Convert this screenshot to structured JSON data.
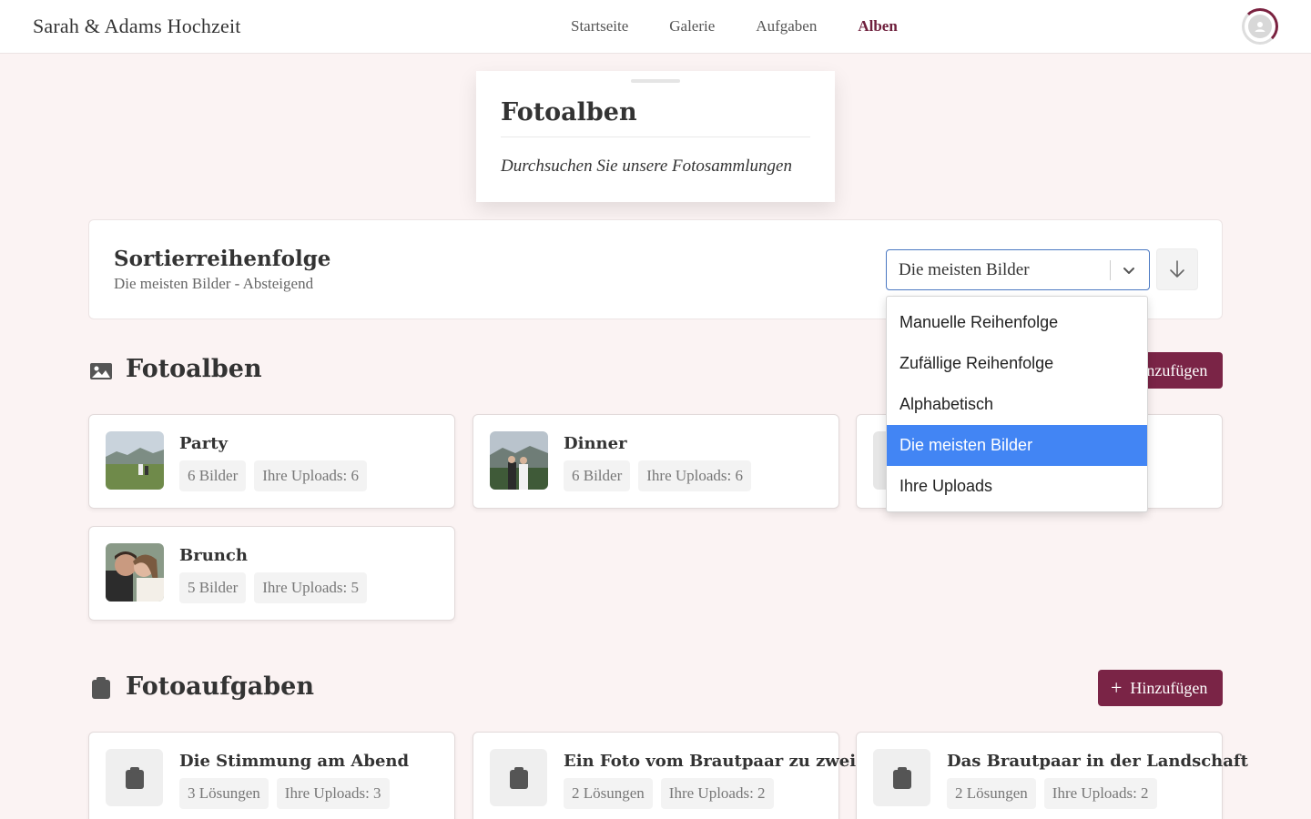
{
  "header": {
    "brand": "Sarah & Adams Hochzeit",
    "nav": [
      "Startseite",
      "Galerie",
      "Aufgaben",
      "Alben"
    ],
    "active_nav": "Alben"
  },
  "hero": {
    "title": "Fotoalben",
    "subtitle": "Durchsuchen Sie unsere Fotosammlungen"
  },
  "sort": {
    "title": "Sortierreihenfolge",
    "summary": "Die meisten Bilder - Absteigend",
    "selected": "Die meisten Bilder",
    "options": [
      "Manuelle Reihenfolge",
      "Zufällige Reihenfolge",
      "Alphabetisch",
      "Die meisten Bilder",
      "Ihre Uploads"
    ],
    "direction_icon": "arrow-down-icon"
  },
  "albums": {
    "title": "Fotoalben",
    "add_label": "Hinzufügen",
    "items": [
      {
        "name": "Party",
        "count": "6 Bilder",
        "uploads": "Ihre Uploads: 6"
      },
      {
        "name": "Dinner",
        "count": "6 Bilder",
        "uploads": "Ihre Uploads: 6"
      },
      {
        "name": "",
        "count": "",
        "uploads": ""
      },
      {
        "name": "Brunch",
        "count": "5 Bilder",
        "uploads": "Ihre Uploads: 5"
      }
    ]
  },
  "tasks": {
    "title": "Fotoaufgaben",
    "add_label": "Hinzufügen",
    "items": [
      {
        "name": "Die Stimmung am Abend",
        "solutions": "3 Lösungen",
        "uploads": "Ihre Uploads: 3"
      },
      {
        "name": "Ein Foto vom Brautpaar zu zweit",
        "solutions": "2 Lösungen",
        "uploads": "Ihre Uploads: 2"
      },
      {
        "name": "Das Brautpaar in der Landschaft",
        "solutions": "2 Lösungen",
        "uploads": "Ihre Uploads: 2"
      }
    ]
  },
  "colors": {
    "accent": "#7a2446",
    "select_border": "#4a78c2",
    "dropdown_selected": "#4285f4",
    "background": "#fbf3f3"
  }
}
